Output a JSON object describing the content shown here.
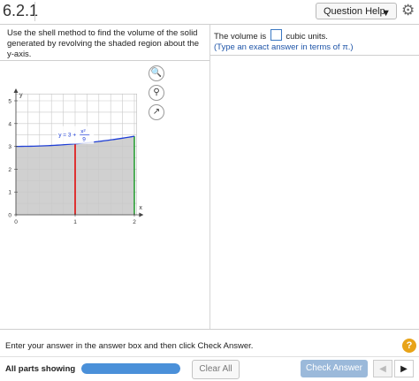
{
  "header": {
    "section_number": "6.2.1",
    "help_label": "Question Help",
    "help_caret_icon": "caret-down-icon",
    "settings_icon": "gear-icon"
  },
  "question": {
    "text": "Use the shell method to find the volume of the solid generated by revolving the shaded region about the y-axis."
  },
  "answer": {
    "prefix": "The volume is",
    "suffix": "cubic units.",
    "value": "",
    "hint": "(Type an exact answer in terms of π.)"
  },
  "graph": {
    "x_tick_labels": [
      "0",
      "1",
      "2"
    ],
    "y_tick_labels": [
      "0",
      "1",
      "2",
      "3",
      "4",
      "5"
    ],
    "x_axis_label": "x",
    "y_axis_label": "y",
    "curve_label_prefix": "y = 3 +",
    "curve_label_numerator": "x²",
    "curve_label_denominator": "9",
    "tools": [
      "zoom-in-icon",
      "zoom-out-icon",
      "popout-icon"
    ],
    "colors": {
      "curve": "#1f3fd6",
      "shade": "#c8c8c8",
      "red_line": "#e02020",
      "green_line": "#1f9a2a"
    }
  },
  "footer": {
    "instruction": "Enter your answer in the answer box and then click Check Answer.",
    "help_mark": "?",
    "parts_label": "All parts showing",
    "progress_fraction": 1.0,
    "clear_label": "Clear All",
    "check_label": "Check Answer",
    "prev_icon": "◀",
    "next_icon": "▶"
  }
}
